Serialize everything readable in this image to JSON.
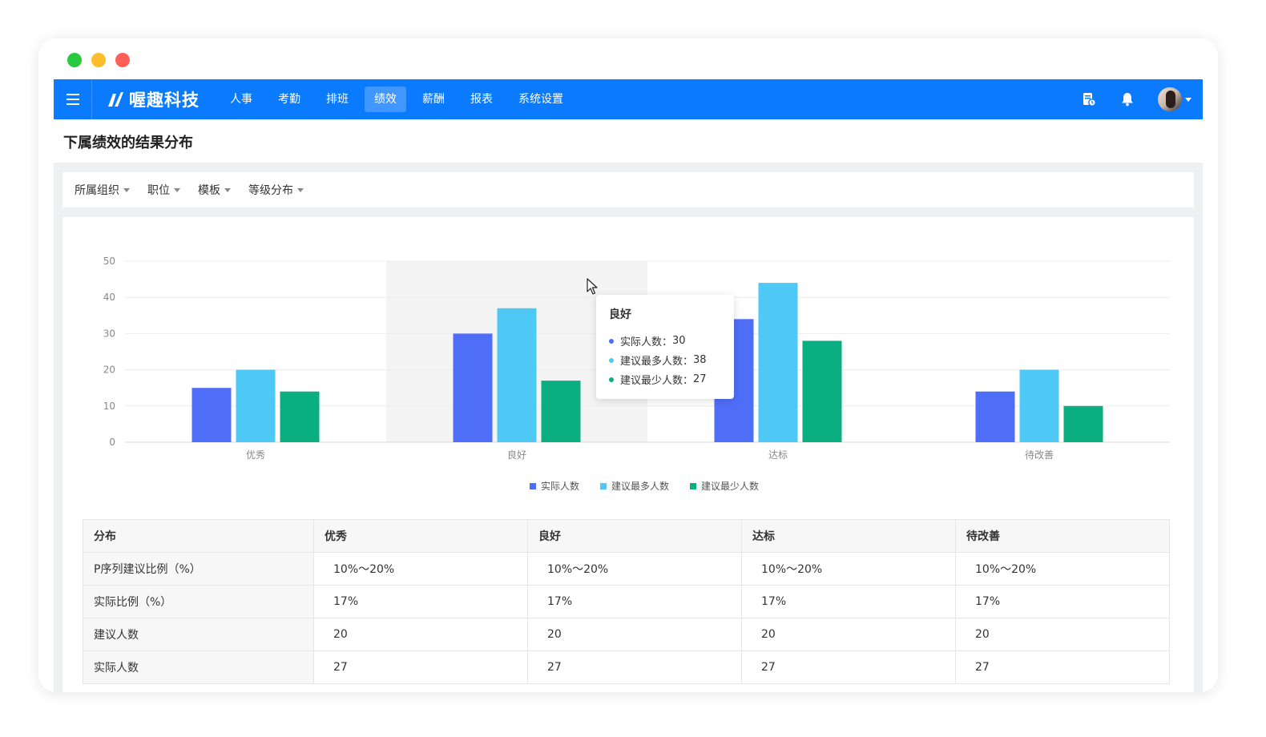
{
  "app": {
    "brand": "喔趣科技",
    "menu": [
      "人事",
      "考勤",
      "排班",
      "绩效",
      "薪酬",
      "报表",
      "系统设置"
    ],
    "active_menu_index": 3
  },
  "page": {
    "title": "下属绩效的结果分布"
  },
  "filters": [
    "所属组织",
    "职位",
    "模板",
    "等级分布"
  ],
  "chart_data": {
    "type": "bar",
    "categories": [
      "优秀",
      "良好",
      "达标",
      "待改善"
    ],
    "series": [
      {
        "name": "实际人数",
        "values": [
          15,
          30,
          34,
          14
        ],
        "color": "#4f6ef7"
      },
      {
        "name": "建议最多人数",
        "values": [
          20,
          37,
          44,
          20
        ],
        "color": "#4ec8f4"
      },
      {
        "name": "建议最少人数",
        "values": [
          14,
          17,
          28,
          10
        ],
        "color": "#0bae80"
      }
    ],
    "ylim": [
      0,
      50
    ],
    "yticks": [
      "0",
      "10",
      "20",
      "30",
      "40",
      "50"
    ],
    "grid": true,
    "legend_position": "bottom",
    "highlighted_category_index": 1
  },
  "tooltip": {
    "title": "良好",
    "rows": [
      {
        "label": "实际人数：",
        "value": "30"
      },
      {
        "label": "建议最多人数：",
        "value": "38"
      },
      {
        "label": "建议最少人数：",
        "value": "27"
      }
    ]
  },
  "table": {
    "headers": [
      "分布",
      "优秀",
      "良好",
      "达标",
      "待改善"
    ],
    "rows": [
      [
        "P序列建议比例（%）",
        "10%～20%",
        "10%～20%",
        "10%～20%",
        "10%～20%"
      ],
      [
        "实际比例（%）",
        "17%",
        "17%",
        "17%",
        "17%"
      ],
      [
        "建议人数",
        "20",
        "20",
        "20",
        "20"
      ],
      [
        "实际人数",
        "27",
        "27",
        "27",
        "27"
      ]
    ]
  }
}
